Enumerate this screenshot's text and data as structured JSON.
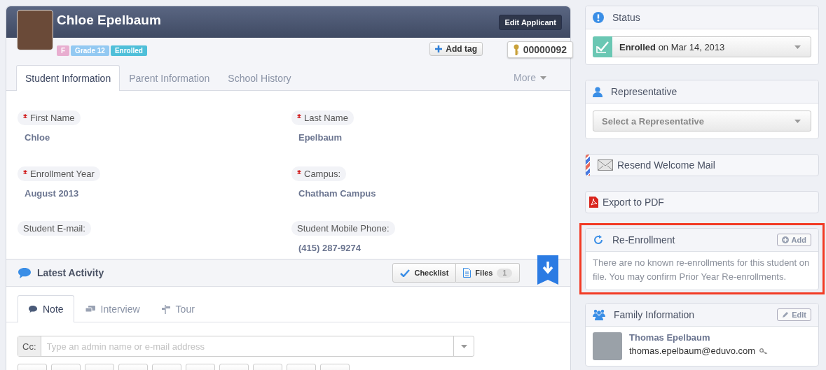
{
  "applicant": {
    "name": "Chloe Epelbaum",
    "edit_button": "Edit Applicant",
    "tags": [
      {
        "label": "F",
        "color": "#e8aed0"
      },
      {
        "label": "Grade 12",
        "color": "#93c9f2"
      },
      {
        "label": "Enrolled",
        "color": "#4fbfd9"
      }
    ],
    "add_tag_button": "Add tag",
    "id_number": "00000092"
  },
  "tabs": [
    {
      "label": "Student Information",
      "selected": true
    },
    {
      "label": "Parent Information",
      "selected": false
    },
    {
      "label": "School History",
      "selected": false
    }
  ],
  "more_menu": "More",
  "fields": [
    {
      "label": "First Name",
      "required": true,
      "value": "Chloe"
    },
    {
      "label": "Last Name",
      "required": true,
      "value": "Epelbaum"
    },
    {
      "label": "Enrollment Year",
      "required": true,
      "value": "August 2013"
    },
    {
      "label": "Campus:",
      "required": true,
      "value": "Chatham Campus"
    },
    {
      "label": "Student E-mail:",
      "required": false
    },
    {
      "label": "Student Mobile Phone:",
      "required": false,
      "value": "(415) 287-9274"
    }
  ],
  "activity": {
    "title": "Latest Activity",
    "checklist_button": "Checklist",
    "files_button": "Files",
    "files_count": "1",
    "tabs": [
      {
        "label": "Note",
        "kind": "note",
        "selected": true
      },
      {
        "label": "Interview",
        "kind": "interview",
        "selected": false
      },
      {
        "label": "Tour",
        "kind": "tour",
        "selected": false
      }
    ],
    "cc_label": "Cc:",
    "cc_placeholder": "Type an admin name or e-mail address"
  },
  "sidebar": {
    "status": {
      "title": "Status",
      "value": "**Enrolled** on Mar 14, 2013"
    },
    "representative": {
      "title": "Representative",
      "placeholder": "Select a Representative"
    },
    "actions": [
      {
        "kind": "mail",
        "label": "Resend Welcome Mail"
      },
      {
        "kind": "pdf",
        "label": "Export to PDF"
      }
    ],
    "re_enrollment": {
      "title": "Re-Enrollment",
      "add_button": "Add",
      "message": "There are no known re-enrollments for this student on file. You may confirm Prior Year Re-enrollments.",
      "highlighted": true
    },
    "family": {
      "title": "Family Information",
      "edit_button": "Edit",
      "members": [
        {
          "name": "Thomas Epelbaum",
          "email": "thomas.epelbaum@eduvo.com"
        }
      ]
    }
  }
}
